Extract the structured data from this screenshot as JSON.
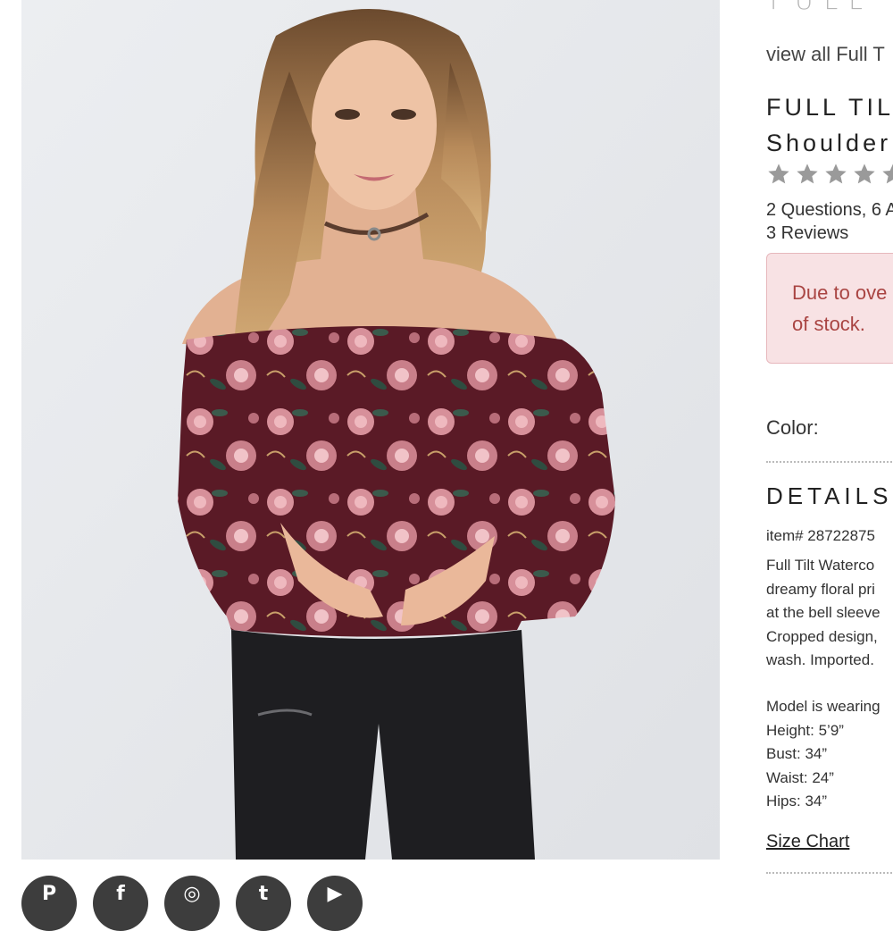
{
  "brand": {
    "logo_text": "FULL"
  },
  "product": {
    "view_all_link": "view all Full T",
    "title_line1": "FULL TIL",
    "title_line2": "Shoulder",
    "rating_stars": 5,
    "questions_answers": "2 Questions, 6 A",
    "reviews": "3 Reviews"
  },
  "stock_alert": {
    "line1": "Due to ove",
    "line2": "of stock."
  },
  "color_label": "Color:",
  "details": {
    "heading": "DETAILS",
    "item_number": "item# 28722875",
    "description_lines": [
      "Full Tilt Waterco",
      "dreamy floral pri",
      "at the bell sleeve",
      "Cropped design,",
      "wash. Imported."
    ],
    "model_lines": [
      "Model is wearing",
      "Height: 5’9”",
      "Bust: 34”",
      "Waist: 24”",
      "Hips: 34”"
    ],
    "size_chart_link": "Size Chart"
  },
  "social_icons": [
    "pinterest-icon",
    "facebook-icon",
    "instagram-icon",
    "twitter-icon",
    "youtube-icon"
  ],
  "colors": {
    "alert_bg": "#f8e2e4",
    "alert_border": "#e7b8bd",
    "alert_text": "#a94442",
    "star_gray": "#9a9a9a",
    "blouse_burgundy": "#5a1a26"
  }
}
